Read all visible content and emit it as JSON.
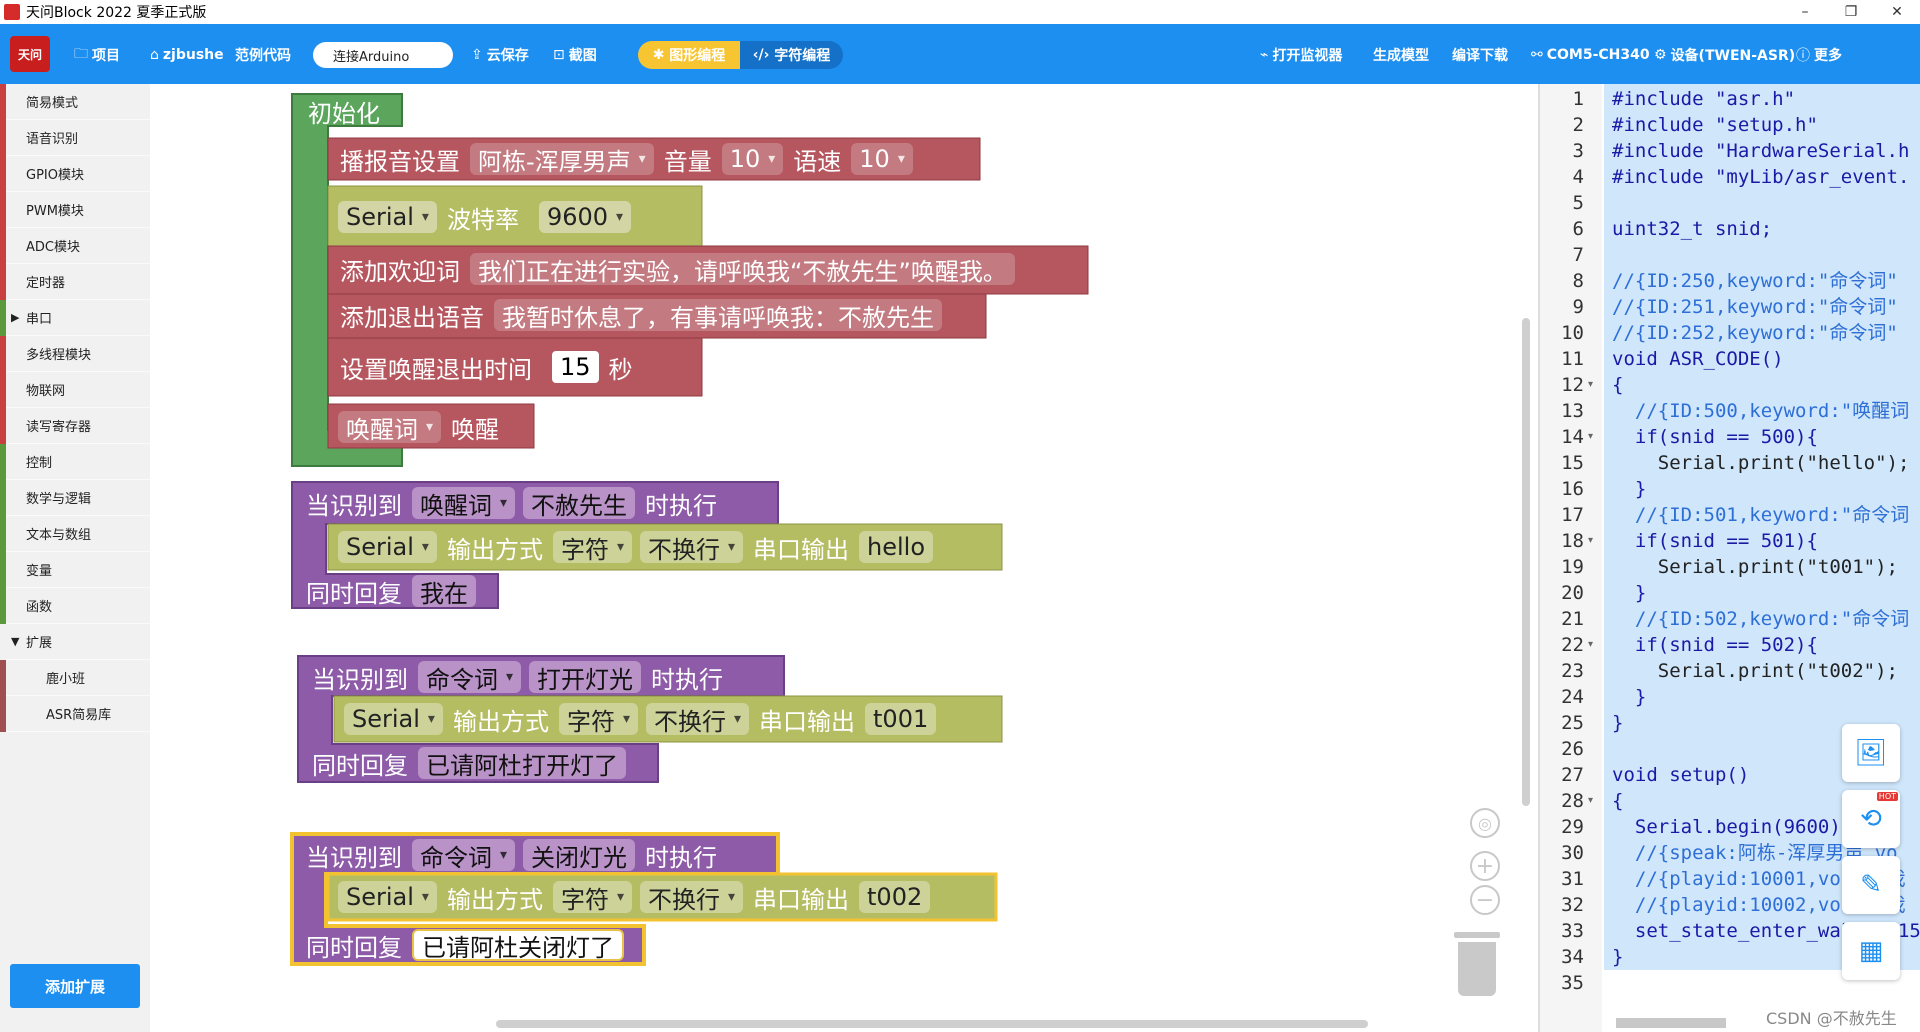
{
  "window": {
    "title": "天问Block 2022 夏季正式版",
    "minimize": "–",
    "maximize": "❐",
    "close": "✕"
  },
  "toolbar": {
    "logo_text": "天问",
    "project": "项目",
    "user": "zjbushe",
    "examples": "范例代码",
    "connect": "连接Arduino",
    "cloud_save": "云保存",
    "screenshot": "截图",
    "graphic_mode": "图形编程",
    "text_mode": "字符编程",
    "open_monitor": "打开监视器",
    "gen_model": "生成模型",
    "compile_download": "编译下载",
    "port": "COM5-CH340",
    "device": "设备(TWEN-ASR)",
    "more": "更多",
    "icons": {
      "project": "folder-icon",
      "user": "home-icon",
      "cloud": "cloud-save-icon",
      "shot": "crop-icon",
      "monitor": "monitor-icon",
      "port": "link-icon",
      "device": "gear-icon",
      "more": "help-icon"
    }
  },
  "sidebar": {
    "categories": [
      {
        "label": "简易模式",
        "color": "#c94040",
        "arrow": ""
      },
      {
        "label": "语音识别",
        "color": "#c94040",
        "arrow": ""
      },
      {
        "label": "GPIO模块",
        "color": "#c94040",
        "arrow": ""
      },
      {
        "label": "PWM模块",
        "color": "#c94040",
        "arrow": ""
      },
      {
        "label": "ADC模块",
        "color": "#c94040",
        "arrow": ""
      },
      {
        "label": "定时器",
        "color": "#c94040",
        "arrow": ""
      },
      {
        "label": "串口",
        "color": "#5b9a3c",
        "arrow": "▶"
      },
      {
        "label": "多线程模块",
        "color": "#c94040",
        "arrow": ""
      },
      {
        "label": "物联网",
        "color": "#c94040",
        "arrow": ""
      },
      {
        "label": "读写寄存器",
        "color": "#c94040",
        "arrow": ""
      },
      {
        "label": "控制",
        "color": "#5b9a3c",
        "arrow": ""
      },
      {
        "label": "数学与逻辑",
        "color": "#5b9a3c",
        "arrow": ""
      },
      {
        "label": "文本与数组",
        "color": "#5b9a3c",
        "arrow": ""
      },
      {
        "label": "变量",
        "color": "#5b9a3c",
        "arrow": ""
      },
      {
        "label": "函数",
        "color": "#5b9a3c",
        "arrow": ""
      },
      {
        "label": "扩展",
        "color": "#f1f1f1",
        "arrow": "▼"
      },
      {
        "label": "鹿小班",
        "color": "#a05050",
        "arrow": ""
      },
      {
        "label": "ASR简易库",
        "color": "#a05050",
        "arrow": ""
      }
    ],
    "add_extension": "添加扩展"
  },
  "blocks": {
    "init": {
      "header": "初始化",
      "tts_label": "播报音设置",
      "voice": "阿栋-浑厚男声",
      "volume_label": "音量",
      "volume": "10",
      "speed_label": "语速",
      "speed": "10",
      "serial": "Serial",
      "baud_label": "波特率",
      "baud": "9600",
      "welcome_label": "添加欢迎词",
      "welcome_text": "我们正在进行实验，请呼唤我“不赦先生”唤醒我。",
      "exit_label": "添加退出语音",
      "exit_text": "我暂时休息了，有事请呼唤我：不赦先生",
      "timeout_label": "设置唤醒退出时间",
      "timeout": "15",
      "timeout_unit": "秒",
      "wake_type": "唤醒词",
      "wake_word": "唤醒"
    },
    "events": [
      {
        "when": "当识别到",
        "type": "唤醒词",
        "keyword": "不赦先生",
        "do": "时执行",
        "serial": "Serial",
        "out_label": "输出方式",
        "out_mode": "字符",
        "newline": "不换行",
        "out_to": "串口输出",
        "out_text": "hello",
        "reply_label": "同时回复",
        "reply": "我在"
      },
      {
        "when": "当识别到",
        "type": "命令词",
        "keyword": "打开灯光",
        "do": "时执行",
        "serial": "Serial",
        "out_label": "输出方式",
        "out_mode": "字符",
        "newline": "不换行",
        "out_to": "串口输出",
        "out_text": "t001",
        "reply_label": "同时回复",
        "reply": "已请阿杜打开灯了"
      },
      {
        "when": "当识别到",
        "type": "命令词",
        "keyword": "关闭灯光",
        "do": "时执行",
        "serial": "Serial",
        "out_label": "输出方式",
        "out_mode": "字符",
        "newline": "不换行",
        "out_to": "串口输出",
        "out_text": "t002",
        "reply_label": "同时回复",
        "reply": "已请阿杜关闭灯了"
      }
    ]
  },
  "workspace_controls": {
    "center": "target-icon",
    "zoom_in": "+",
    "zoom_out": "−",
    "trash": "trash-icon"
  },
  "editor": {
    "lines": [
      "#include \"asr.h\"",
      "#include \"setup.h\"",
      "#include \"HardwareSerial.h",
      "#include \"myLib/asr_event.",
      "",
      "uint32_t snid;",
      "",
      "//{ID:250,keyword:\"命令词\"",
      "//{ID:251,keyword:\"命令词\"",
      "//{ID:252,keyword:\"命令词\"",
      "void ASR_CODE()",
      "{",
      "  //{ID:500,keyword:\"唤醒词",
      "  if(snid == 500){",
      "    Serial.print(\"hello\");",
      "  }",
      "  //{ID:501,keyword:\"命令词",
      "  if(snid == 501){",
      "    Serial.print(\"t001\");",
      "  }",
      "  //{ID:502,keyword:\"命令词",
      "  if(snid == 502){",
      "    Serial.print(\"t002\");",
      "  }",
      "}",
      "",
      "void setup()",
      "{",
      "  Serial.begin(9600);",
      "  //{speak:阿栋-浑厚男声,vo",
      "  //{playid:10001,voice:我",
      "  //{playid:10002,voice:我",
      "  set_state_enter_wakeup(15",
      "}",
      ""
    ],
    "folds": [
      12,
      14,
      18,
      22,
      28
    ]
  },
  "float_buttons": [
    "image-add-icon",
    "share-icon",
    "edit-icon",
    "qrcode-icon"
  ],
  "hot_badge": "HOT",
  "watermark": "CSDN @不赦先生"
}
